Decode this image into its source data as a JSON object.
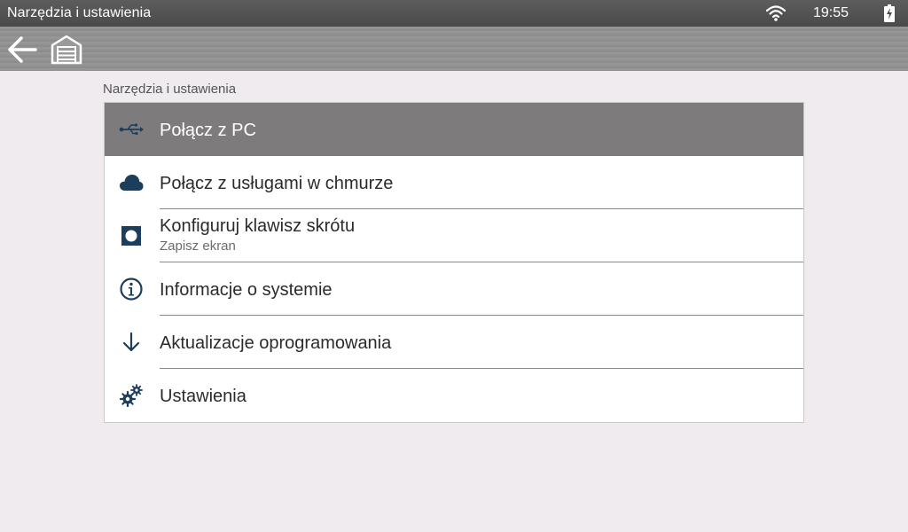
{
  "status_bar": {
    "title": "Narzędzia i ustawienia",
    "time": "19:55",
    "icons": [
      "wifi-icon",
      "battery-charging-icon"
    ]
  },
  "toolbar": {
    "buttons": [
      "back-arrow-icon",
      "home-garage-icon"
    ]
  },
  "section": {
    "label": "Narzędzia i ustawienia"
  },
  "menu": {
    "items": [
      {
        "label": "Połącz z PC",
        "icon": "usb-icon",
        "selected": true
      },
      {
        "label": "Połącz z usługami w chmurze",
        "icon": "cloud-icon"
      },
      {
        "label": "Konfiguruj klawisz skrótu",
        "sublabel": "Zapisz ekran",
        "icon": "shortcut-key-icon"
      },
      {
        "label": "Informacje o systemie",
        "icon": "info-icon"
      },
      {
        "label": "Aktualizacje oprogramowania",
        "icon": "download-arrow-icon"
      },
      {
        "label": "Ustawienia",
        "icon": "gears-icon"
      }
    ]
  },
  "colors": {
    "icon": "#1d3d5c",
    "selected_row": "#7e7b7c",
    "background": "#efebee"
  }
}
